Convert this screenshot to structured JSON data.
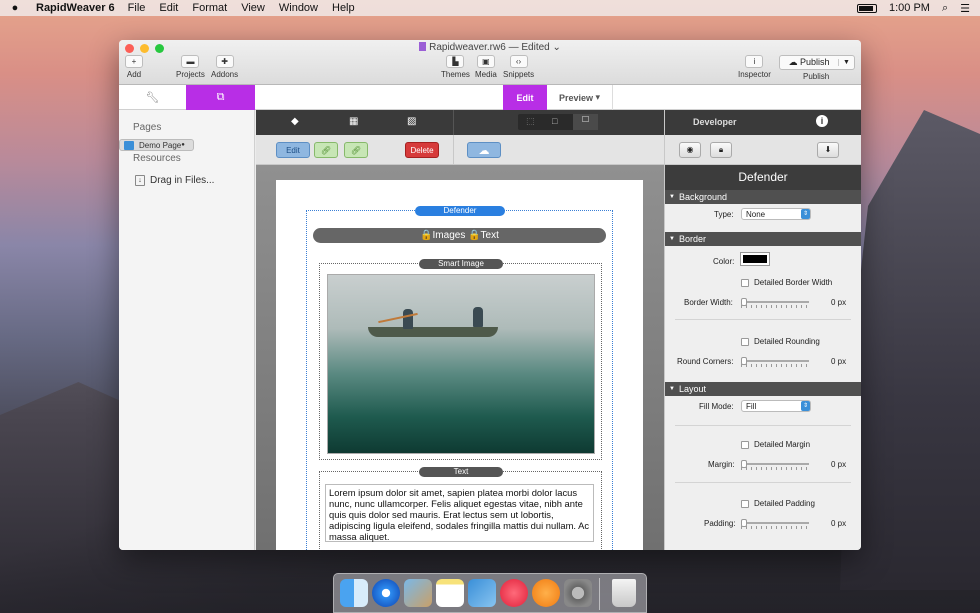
{
  "menubar": {
    "apple": "",
    "app": "RapidWeaver 6",
    "items": [
      "File",
      "Edit",
      "Format",
      "View",
      "Window",
      "Help"
    ],
    "clock": "1:00 PM"
  },
  "window": {
    "doc_name": "Rapidweaver.rw6",
    "status": "Edited",
    "toolbar": {
      "add": "Add",
      "projects": "Projects",
      "addons": "Addons",
      "themes": "Themes",
      "media": "Media",
      "snippets": "Snippets",
      "inspector": "Inspector",
      "publish_btn": "Publish",
      "publish_lbl": "Publish"
    },
    "tabs": {
      "edit": "Edit",
      "preview": "Preview"
    }
  },
  "sidebar": {
    "pages_header": "Pages",
    "pages": [
      {
        "label": "Demo Page"
      }
    ],
    "resources_header": "Resources",
    "resources": [
      {
        "label": "Drag in Files..."
      }
    ]
  },
  "editor": {
    "buttons": {
      "edit": "Edit",
      "delete": "Delete"
    },
    "defender_label": "Defender",
    "lock_bar": "🔒Images 🔒Text",
    "smart_image_label": "Smart Image",
    "text_label": "Text",
    "body_text": "Lorem ipsum dolor sit amet, sapien platea morbi dolor lacus nunc, nunc ullamcorper. Felis aliquet egestas vitae, nibh ante quis quis dolor sed mauris. Erat lectus sem ut lobortis, adipiscing ligula eleifend, sodales fringilla mattis dui nullam. Ac massa aliquet."
  },
  "inspector": {
    "tab": "Developer",
    "title": "Defender",
    "background": {
      "header": "Background",
      "type_label": "Type:",
      "type_value": "None"
    },
    "border": {
      "header": "Border",
      "color_label": "Color:",
      "color_value": "#000000",
      "detailed_width": "Detailed Border Width",
      "width_label": "Border Width:",
      "width_value": "0 px",
      "detailed_rounding": "Detailed Rounding",
      "corners_label": "Round Corners:",
      "corners_value": "0 px"
    },
    "layout": {
      "header": "Layout",
      "fill_label": "Fill Mode:",
      "fill_value": "Fill",
      "detailed_margin": "Detailed Margin",
      "margin_label": "Margin:",
      "margin_value": "0 px",
      "detailed_padding": "Detailed Padding",
      "padding_label": "Padding:",
      "padding_value": "0 px"
    }
  },
  "colors": {
    "accent": "#b82ee6",
    "edit_blue": "#3a8fd8",
    "delete_red": "#d63a3a"
  }
}
